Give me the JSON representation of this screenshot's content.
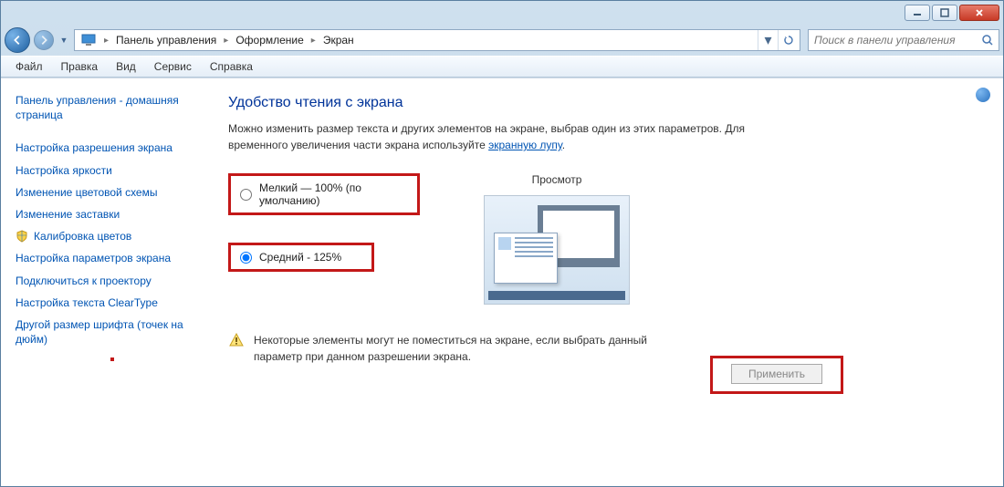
{
  "breadcrumb": {
    "root": "Панель управления",
    "mid": "Оформление",
    "leaf": "Экран"
  },
  "search": {
    "placeholder": "Поиск в панели управления"
  },
  "menu": {
    "file": "Файл",
    "edit": "Правка",
    "view": "Вид",
    "tools": "Сервис",
    "help": "Справка"
  },
  "sidebar": {
    "home": "Панель управления - домашняя страница",
    "links": [
      "Настройка разрешения экрана",
      "Настройка яркости",
      "Изменение цветовой схемы",
      "Изменение заставки",
      "Калибровка цветов",
      "Настройка параметров экрана",
      "Подключиться к проектору",
      "Настройка текста ClearType",
      "Другой размер шрифта (точек на дюйм)"
    ]
  },
  "main": {
    "title": "Удобство чтения с экрана",
    "desc_a": "Можно изменить размер текста и других элементов на экране, выбрав один из этих параметров. Для временного увеличения части экрана используйте ",
    "desc_link": "экранную лупу",
    "desc_b": ".",
    "opt_small": "Мелкий — 100% (по умолчанию)",
    "opt_medium": "Средний - 125%",
    "preview": "Просмотр",
    "warning": "Некоторые элементы могут не поместиться на экране, если выбрать данный параметр при данном разрешении экрана.",
    "apply": "Применить"
  },
  "help_glyph": "?"
}
